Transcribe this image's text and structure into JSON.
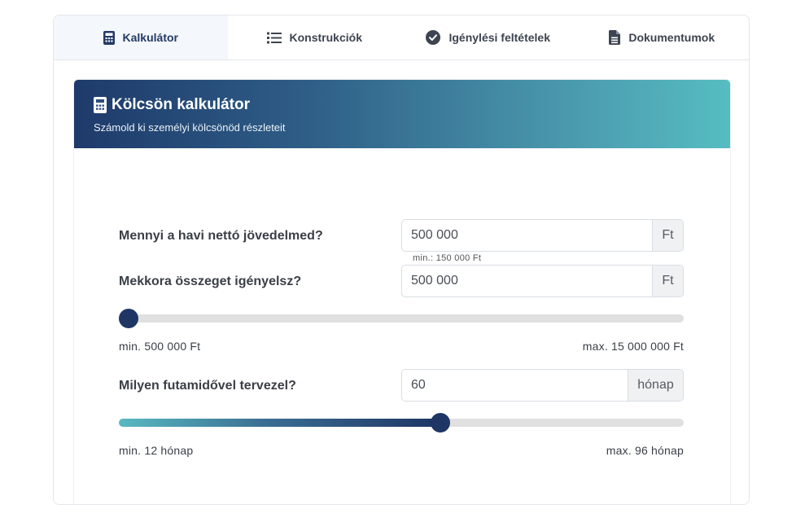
{
  "tabs": [
    {
      "label": "Kalkulátor",
      "icon": "calculator-icon",
      "active": true
    },
    {
      "label": "Konstrukciók",
      "icon": "list-icon",
      "active": false
    },
    {
      "label": "Igénylési feltételek",
      "icon": "check-circle-icon",
      "active": false
    },
    {
      "label": "Dokumentumok",
      "icon": "document-icon",
      "active": false
    }
  ],
  "header": {
    "title": "Kölcsön kalkulátor",
    "subtitle": "Számold ki személyi kölcsönöd részleteit",
    "icon": "calculator-icon"
  },
  "income": {
    "label": "Mennyi a havi nettó jövedelmed?",
    "value": "500 000",
    "unit": "Ft",
    "hint": "min.: 150 000 Ft"
  },
  "amount": {
    "label": "Mekkora összeget igényelsz?",
    "value": "500 000",
    "unit": "Ft",
    "min_label": "min. 500 000 Ft",
    "max_label": "max. 15 000 000 Ft",
    "slider_fraction": 0
  },
  "term": {
    "label": "Milyen futamidővel tervezel?",
    "value": "60",
    "unit": "hónap",
    "min_label": "min. 12 hónap",
    "max_label": "max. 96 hónap",
    "slider_fraction": 0.5714
  },
  "colors": {
    "primary": "#1f3564",
    "accent": "#56bdc2",
    "track": "#e0e0e0"
  }
}
